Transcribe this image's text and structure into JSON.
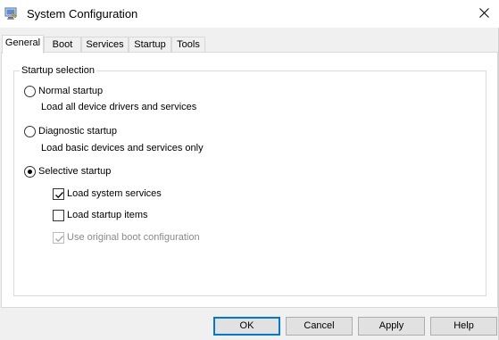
{
  "window": {
    "title": "System Configuration",
    "icons": {
      "app": "system-config-icon",
      "close": "close-icon"
    }
  },
  "tabs": [
    {
      "label": "General",
      "active": true
    },
    {
      "label": "Boot",
      "active": false
    },
    {
      "label": "Services",
      "active": false
    },
    {
      "label": "Startup",
      "active": false
    },
    {
      "label": "Tools",
      "active": false
    }
  ],
  "startup_selection": {
    "legend": "Startup selection",
    "normal": {
      "label": "Normal startup",
      "description": "Load all device drivers and services",
      "selected": false
    },
    "diagnostic": {
      "label": "Diagnostic startup",
      "description": "Load basic devices and services only",
      "selected": false
    },
    "selective": {
      "label": "Selective startup",
      "selected": true,
      "options": [
        {
          "label": "Load system services",
          "checked": true,
          "enabled": true
        },
        {
          "label": "Load startup items",
          "checked": false,
          "enabled": true
        },
        {
          "label": "Use original boot configuration",
          "checked": true,
          "enabled": false
        }
      ]
    }
  },
  "buttons": {
    "ok": "OK",
    "cancel": "Cancel",
    "apply": "Apply",
    "help": "Help"
  },
  "colors": {
    "accent": "#0078d7",
    "disabled_text": "#8a8a8a"
  }
}
